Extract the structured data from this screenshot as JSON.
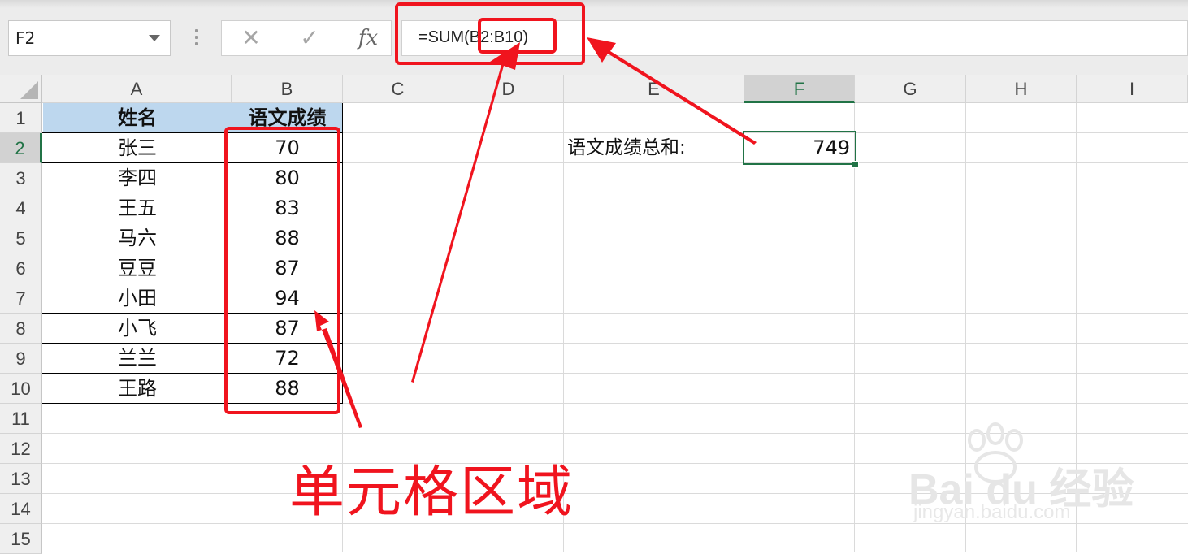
{
  "namebox": {
    "value": "F2"
  },
  "formula_buttons": {
    "cancel": "✕",
    "enter": "✓",
    "fx": "fx"
  },
  "formula": {
    "text": "=SUM(B2:B10)"
  },
  "columns": [
    "A",
    "B",
    "C",
    "D",
    "E",
    "F",
    "G",
    "H",
    "I"
  ],
  "rows": [
    "1",
    "2",
    "3",
    "4",
    "5",
    "6",
    "7",
    "8",
    "9",
    "10",
    "11",
    "12",
    "13",
    "14",
    "15"
  ],
  "table": {
    "header": {
      "name": "姓名",
      "score": "语文成绩"
    },
    "records": [
      {
        "name": "张三",
        "score": "70"
      },
      {
        "name": "李四",
        "score": "80"
      },
      {
        "name": "王五",
        "score": "83"
      },
      {
        "name": "马六",
        "score": "88"
      },
      {
        "name": "豆豆",
        "score": "87"
      },
      {
        "name": "小田",
        "score": "94"
      },
      {
        "name": "小飞",
        "score": "87"
      },
      {
        "name": "兰兰",
        "score": "72"
      },
      {
        "name": "王路",
        "score": "88"
      }
    ]
  },
  "summary": {
    "label": "语文成绩总和:",
    "value": "749"
  },
  "annotation": {
    "text": "单元格区域"
  },
  "watermark": {
    "brand": "Bai du 经验",
    "url": "jingyan.baidu.com"
  },
  "colors": {
    "accent": "#217346",
    "header_fill": "#bdd7ee",
    "annotation_red": "#f0141e"
  }
}
